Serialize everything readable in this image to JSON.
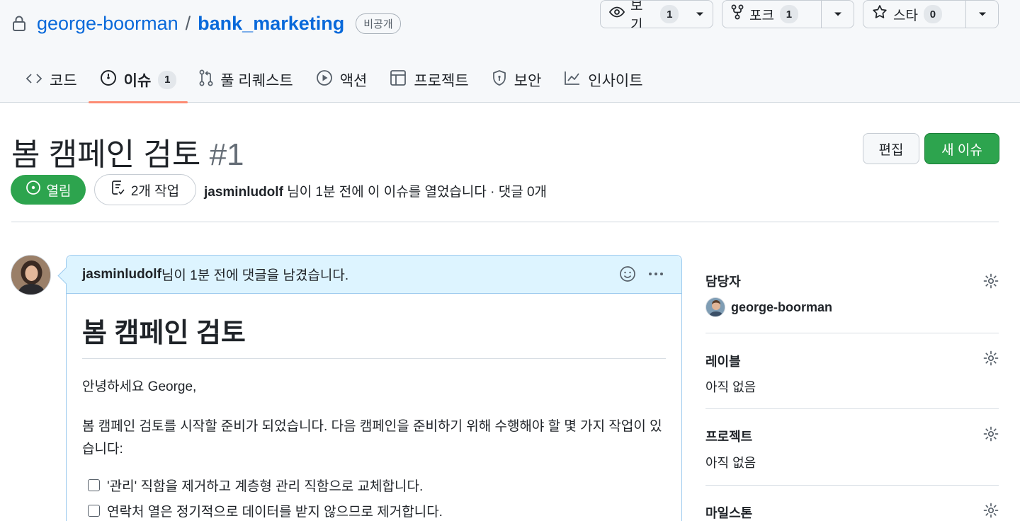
{
  "repo": {
    "owner": "george-boorman",
    "separator": "/",
    "name": "bank_marketing",
    "visibility": "비공개"
  },
  "repo_actions": {
    "watch": {
      "label": "보기",
      "count": "1"
    },
    "fork": {
      "label": "포크",
      "count": "1"
    },
    "star": {
      "label": "스타",
      "count": "0"
    }
  },
  "tabs": [
    {
      "label": "코드",
      "icon": "code-icon"
    },
    {
      "label": "이슈",
      "icon": "issue-opened-icon",
      "count": "1",
      "active": true
    },
    {
      "label": "풀 리퀘스트",
      "icon": "git-pull-request-icon"
    },
    {
      "label": "액션",
      "icon": "play-icon"
    },
    {
      "label": "프로젝트",
      "icon": "table-icon"
    },
    {
      "label": "보안",
      "icon": "shield-icon"
    },
    {
      "label": "인사이트",
      "icon": "graph-icon"
    }
  ],
  "issue": {
    "title": "봄 캠페인 검토",
    "number": "#1",
    "edit_label": "편집",
    "new_issue_label": "새 이슈",
    "state": "열림",
    "tasks": "2개 작업",
    "author": "jasminludolf",
    "meta_text": " 님이 1분 전에 이 이슈를 열었습니다 · 댓글 0개"
  },
  "comment": {
    "author": "jasminludolf",
    "header_text": " 님이 1분 전에 댓글을 남겼습니다.",
    "heading": "봄 캠페인 검토",
    "greeting": "안녕하세요 George,",
    "paragraph": "봄 캠페인 검토를 시작할 준비가 되었습니다. 다음 캠페인을 준비하기 위해 수행해야 할 몇 가지 작업이 있습니다:",
    "tasks": [
      "'관리' 직함을 제거하고 계층형 관리 직함으로 교체합니다.",
      "연락처 열은 정기적으로 데이터를 받지 않으므로 제거합니다."
    ]
  },
  "sidebar": {
    "assignees": {
      "heading": "담당자",
      "value": "george-boorman"
    },
    "labels": {
      "heading": "레이블",
      "value": "아직 없음"
    },
    "projects": {
      "heading": "프로젝트",
      "value": "아직 없음"
    },
    "milestone": {
      "heading": "마일스톤"
    }
  },
  "colors": {
    "link": "#0969da",
    "open_green": "#2da44e",
    "tab_underline": "#fd8c73",
    "comment_header_bg": "#ddf4ff"
  }
}
